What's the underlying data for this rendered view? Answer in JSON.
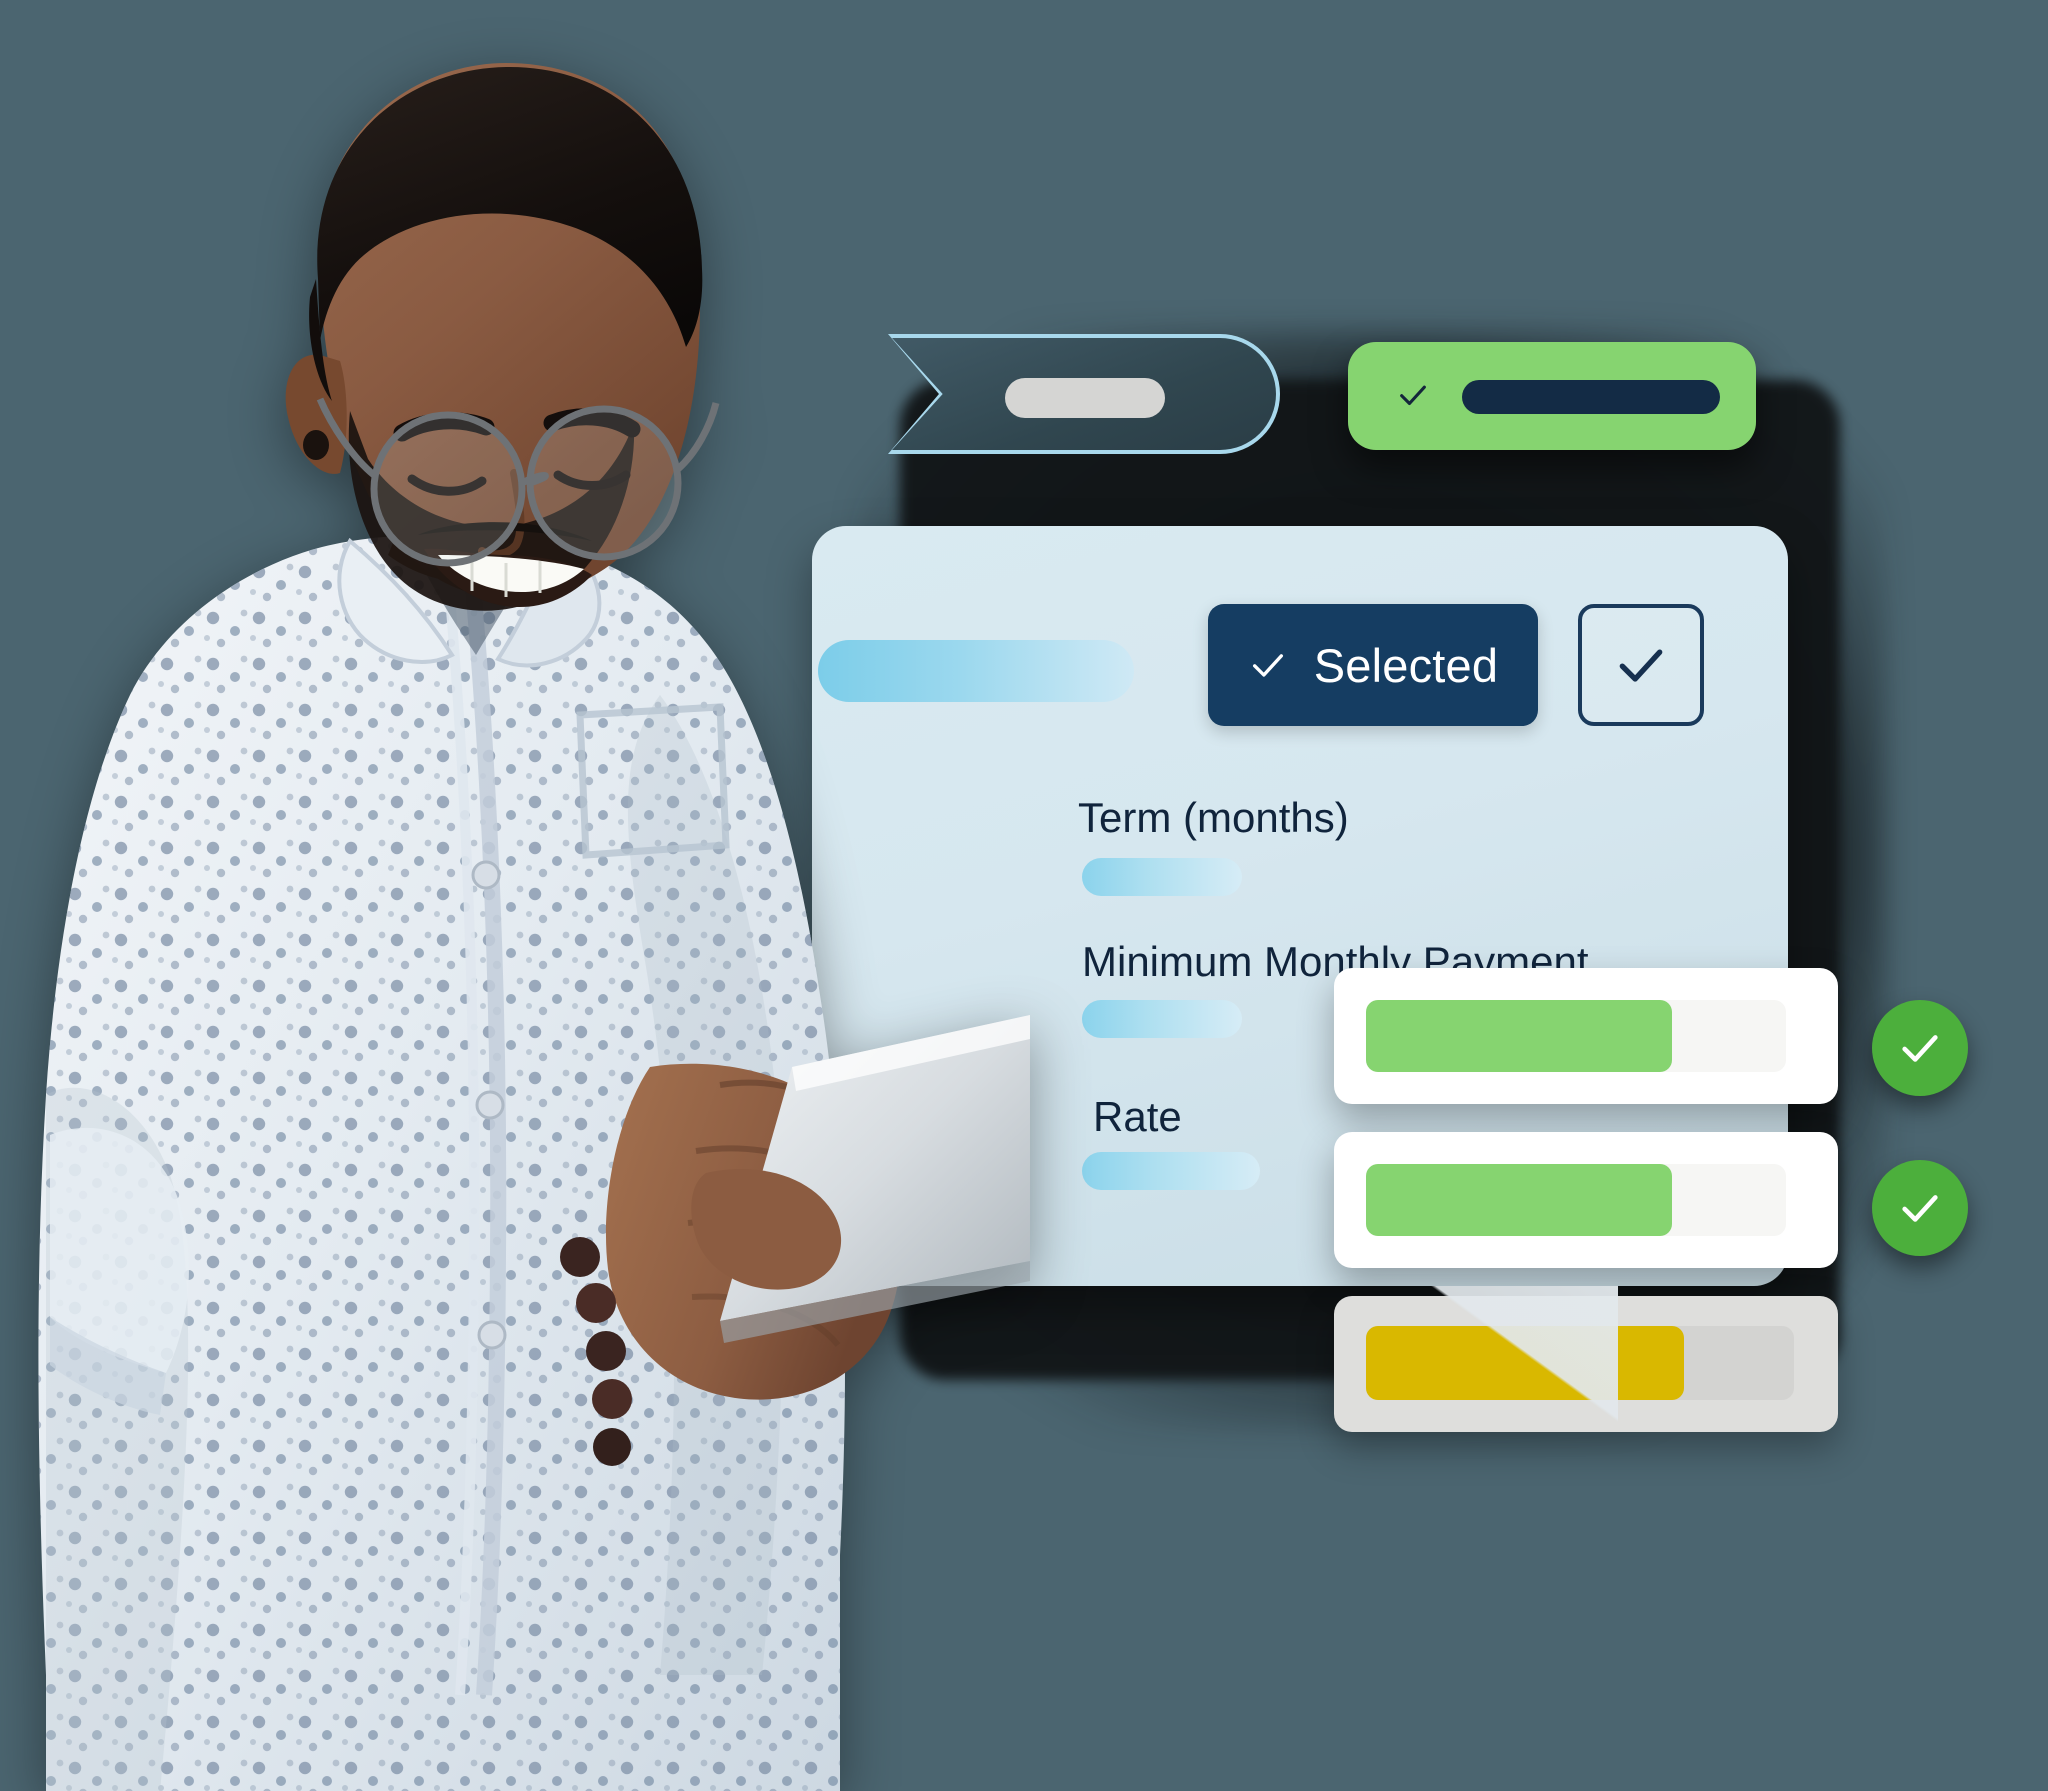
{
  "page": {
    "background_color": "#4B6570",
    "theme_navy": "#153D62",
    "theme_green": "#86D470",
    "theme_green_dark": "#4CAF3C",
    "theme_gold": "#D9B800",
    "panel_background": "#D6E7EF"
  },
  "hero": {
    "subject": "smiling-man-with-glasses-holding-tablet"
  },
  "top_badges": {
    "ribbon": {
      "name": "dark-ribbon-banner",
      "border_color": "#A8D8EC",
      "fill_color": "#30464F",
      "inner_pill_color": "#D5D5D3",
      "label": ""
    },
    "green": {
      "name": "green-approval-badge",
      "fill_color": "#86D470",
      "icon": "check-icon",
      "inner_bar_color": "#132B45",
      "label": ""
    }
  },
  "panel": {
    "top_pill": {
      "name": "loading-pill",
      "label": ""
    },
    "selected_button": {
      "label": "Selected",
      "icon": "check-icon",
      "background": "#153D62",
      "text_color": "#FFFFFF"
    },
    "checkbox": {
      "name": "checked-checkbox",
      "icon": "check-icon",
      "checked": true,
      "border_color": "#1A3A5C"
    },
    "fields": [
      {
        "label": "Term (months)",
        "value": ""
      },
      {
        "label": "Minimum Monthly Payment",
        "value": ""
      },
      {
        "label": "Rate",
        "value": ""
      }
    ]
  },
  "offer_cards": [
    {
      "name": "offer-card-1",
      "bar_color": "#86D470",
      "track_color": "#F6F6F4",
      "fill_percent": 73,
      "card_color": "#FFFFFF",
      "status": "approved"
    },
    {
      "name": "offer-card-2",
      "bar_color": "#86D470",
      "track_color": "#F6F6F4",
      "fill_percent": 73,
      "card_color": "#FFFFFF",
      "status": "approved"
    },
    {
      "name": "offer-card-3",
      "bar_color": "#D9B800",
      "track_color": "#D3D3D1",
      "fill_percent": 74,
      "card_color": "#DEDEDC",
      "status": "pending"
    }
  ],
  "status_indicators": [
    {
      "name": "status-check-1",
      "icon": "check-circle-icon",
      "color": "#4CAF3C"
    },
    {
      "name": "status-check-2",
      "icon": "check-circle-icon",
      "color": "#4CAF3C"
    }
  ]
}
